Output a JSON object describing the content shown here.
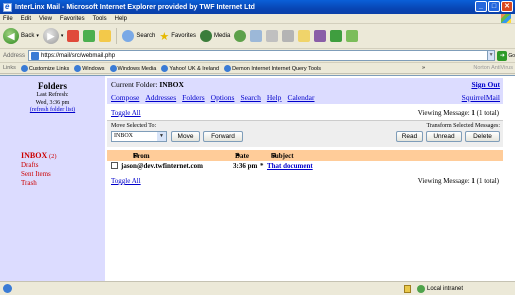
{
  "window": {
    "title": "InterLinx Mail - Microsoft Internet Explorer provided by TWF Internet Ltd",
    "buttons": [
      "_",
      "□",
      "✕"
    ]
  },
  "menubar": [
    "File",
    "Edit",
    "View",
    "Favorites",
    "Tools",
    "Help"
  ],
  "toolbar": {
    "back": "Back",
    "search": "Search",
    "favorites": "Favorites",
    "media": "Media"
  },
  "address": {
    "label": "Address",
    "url": "https://mail/src/webmail.php",
    "go": "Go"
  },
  "links": {
    "label": "Links",
    "items": [
      "Customize Links",
      "Windows",
      "Windows Media",
      "Yahoo! UK & Ireland",
      "Demon Internet Internet Query Tools"
    ],
    "overflow": "»",
    "norton": "Norton AntiVirus"
  },
  "sidebar": {
    "title": "Folders",
    "last_refresh_label": "Last Refresh:",
    "last_refresh_value": "Wed, 3:36 pm",
    "refresh_link": "(refresh folder list)",
    "folders": [
      {
        "name": "INBOX",
        "count": "(2)"
      },
      {
        "name": "Drafts"
      },
      {
        "name": "Sent Items"
      },
      {
        "name": "Trash"
      }
    ]
  },
  "header": {
    "current_folder_label": "Current Folder:",
    "current_folder": "INBOX",
    "sign_out": "Sign Out",
    "nav": [
      "Compose",
      "Addresses",
      "Folders",
      "Options",
      "Search",
      "Help",
      "Calendar"
    ],
    "brand": "SquirrelMail"
  },
  "listing": {
    "toggle_all": "Toggle All",
    "viewing_prefix": "Viewing Message:",
    "viewing_count": "1",
    "viewing_total": "(1 total)",
    "move_label": "Move Selected To:",
    "transform_label": "Transform Selected Messages:",
    "move_target": "INBOX",
    "buttons": {
      "move": "Move",
      "forward": "Forward",
      "read": "Read",
      "unread": "Unread",
      "delete": "Delete"
    },
    "columns": {
      "from": "From",
      "date": "Date",
      "subject": "Subject"
    },
    "messages": [
      {
        "from": "jason@dev.twfinternet.com",
        "date": "3:36 pm",
        "flag": "*",
        "subject": "That document"
      }
    ]
  },
  "status": {
    "zone": "Local intranet"
  }
}
